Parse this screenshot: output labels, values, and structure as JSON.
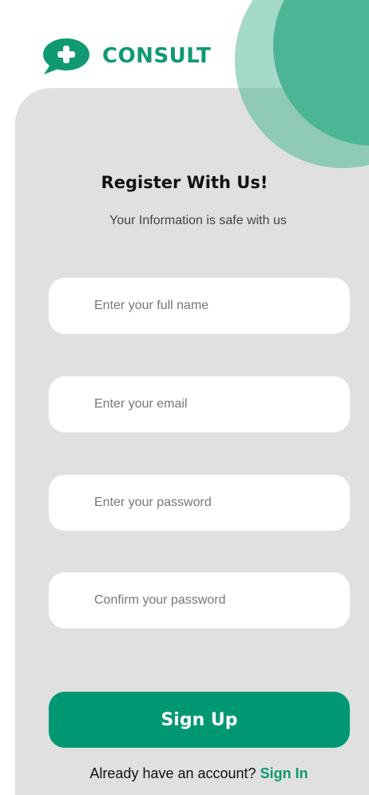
{
  "brand": {
    "name": "CONSULT",
    "logo_icon": "medical-chat-plus-icon"
  },
  "form": {
    "title": "Register With Us!",
    "subtitle": "Your Information is safe with us",
    "fields": {
      "full_name": {
        "placeholder": "Enter your full name",
        "value": ""
      },
      "email": {
        "placeholder": "Enter your email",
        "value": ""
      },
      "password": {
        "placeholder": "Enter your password",
        "value": ""
      },
      "confirm_password": {
        "placeholder": "Confirm your password",
        "value": ""
      }
    },
    "submit_label": "Sign Up"
  },
  "footer": {
    "prompt": "Already have an account?",
    "link_label": "Sign In"
  },
  "colors": {
    "accent": "#009873",
    "brand_text": "#0f9973",
    "card_background": "#e0e0e0",
    "circle_light": "#a5d9c9",
    "circle_dark": "#4cb596"
  }
}
